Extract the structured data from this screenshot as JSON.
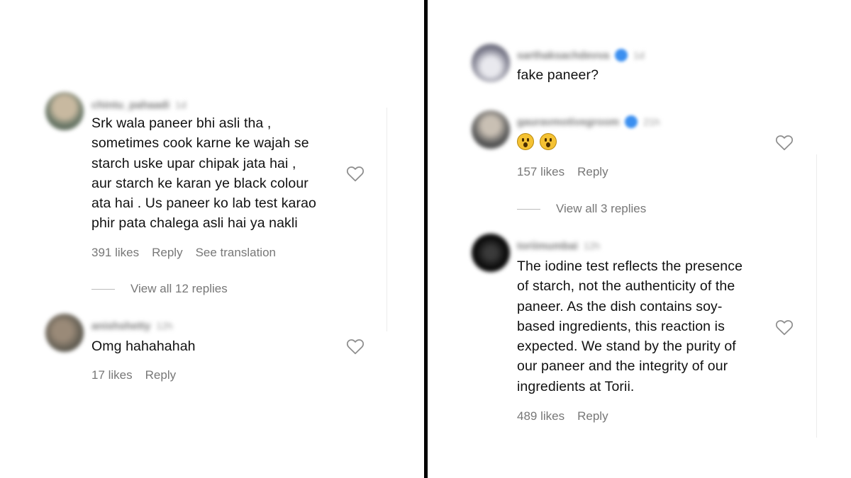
{
  "left_panel": {
    "comments": [
      {
        "username": "chintu_pahaadi",
        "time": "1d",
        "lines": [
          "Srk wala paneer bhi asli tha ,",
          "sometimes cook karne ke wajah se",
          "starch uske upar chipak jata hai ,",
          "aur starch ke karan ye black colour",
          "ata hai . Us paneer ko lab test karao",
          "phir pata chalega asli hai ya nakli"
        ],
        "likes": "391 likes",
        "reply": "Reply",
        "translate": "See translation",
        "view_replies": "View all 12 replies"
      },
      {
        "username": "anishshetty",
        "time": "12h",
        "lines": [
          "Omg hahahahah"
        ],
        "likes": "17 likes",
        "reply": "Reply"
      }
    ]
  },
  "right_panel": {
    "comments": [
      {
        "username": "sarthaksachdevva",
        "time": "1d",
        "lines": [
          "fake paneer?"
        ]
      },
      {
        "username": "gauravmotivegroom",
        "time": "21h",
        "emoji_names": [
          "astonished-face-emoji",
          "astonished-face-emoji"
        ],
        "likes": "157 likes",
        "reply": "Reply",
        "view_replies": "View all 3 replies"
      },
      {
        "username": "toriimumbai",
        "time": "12h",
        "lines": [
          "The iodine test reflects the presence",
          "of starch, not the authenticity of the",
          "paneer. As the dish contains soy-",
          "based ingredients, this reaction is",
          "expected. We stand by the purity of",
          "our paneer and the integrity of our",
          "ingredients at Torii."
        ],
        "likes": "489 likes",
        "reply": "Reply"
      }
    ]
  },
  "colors": {
    "divider": "#000000",
    "meta_text": "#777777",
    "verified_badge": "#3b8ff0",
    "heart_outline": "#8e8e8e"
  }
}
